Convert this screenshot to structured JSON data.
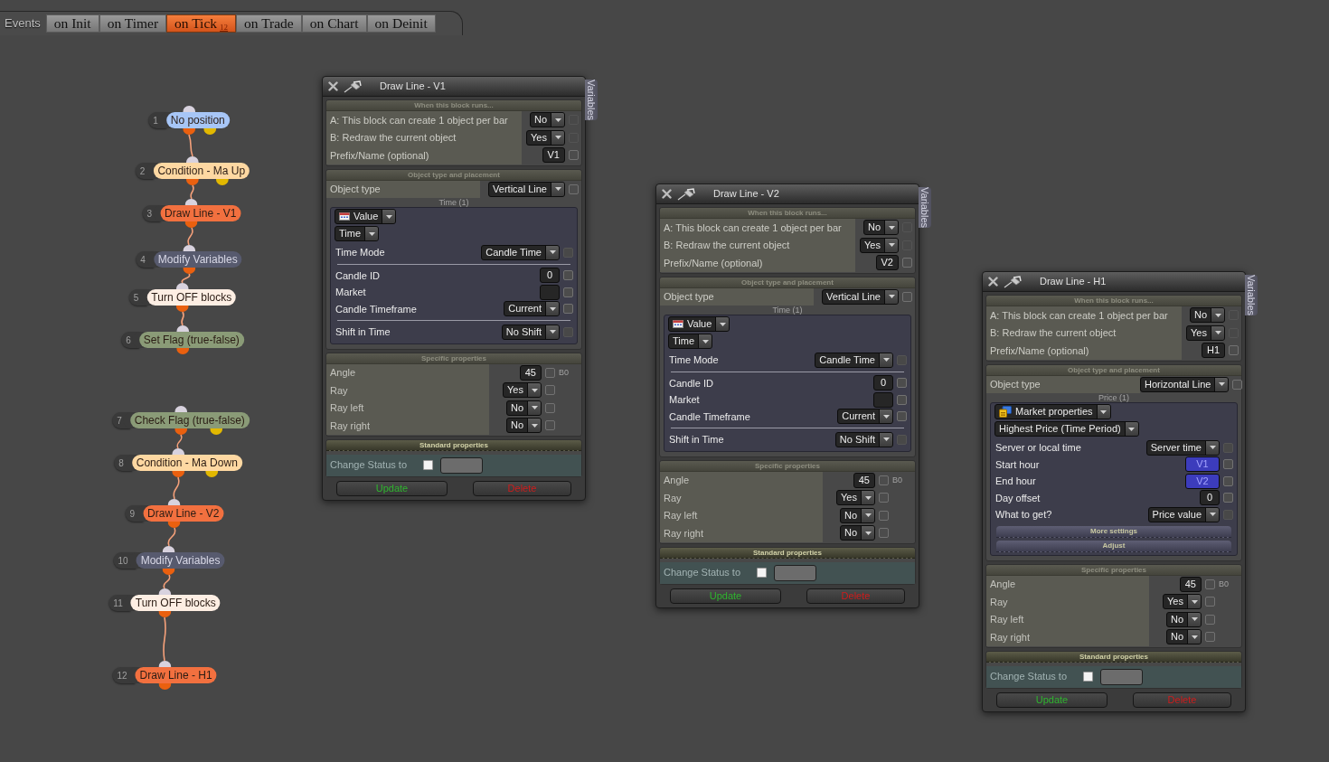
{
  "events_bar": {
    "label": "Events",
    "tabs": [
      {
        "label": "on Init",
        "selected": false
      },
      {
        "label": "on Timer",
        "selected": false
      },
      {
        "label": "on Tick",
        "selected": true,
        "badge": "12"
      },
      {
        "label": "on Trade",
        "selected": false
      },
      {
        "label": "on Chart",
        "selected": false
      },
      {
        "label": "on Deinit",
        "selected": false
      }
    ]
  },
  "flow": {
    "nodes": [
      {
        "number": "1",
        "label": "No position",
        "color": "#a7c6f7",
        "branch_port": true,
        "linked_to_next": true
      },
      {
        "number": "2",
        "label": "Condition - Ma Up",
        "color": "#fed8a2",
        "branch_port": true,
        "linked_to_next": true
      },
      {
        "number": "3",
        "label": "Draw Line - V1",
        "color": "#f2703f",
        "branch_port": false,
        "linked_to_next": true
      },
      {
        "number": "4",
        "label": "Modify Variables",
        "color": "#575a6e",
        "branch_port": false,
        "linked_to_next": true
      },
      {
        "number": "5",
        "label": "Turn OFF blocks",
        "color": "#fdeee3",
        "branch_port": false,
        "linked_to_next": true
      },
      {
        "number": "6",
        "label": "Set Flag (true-false)",
        "color": "#8a9b77",
        "branch_port": false,
        "linked_to_next": false
      },
      {
        "number": "7",
        "label": "Check Flag (true-false)",
        "color": "#8a9b77",
        "branch_port": true,
        "linked_to_next": true
      },
      {
        "number": "8",
        "label": "Condition - Ma Down",
        "color": "#fed8a2",
        "branch_port": true,
        "linked_to_next": true
      },
      {
        "number": "9",
        "label": "Draw Line - V2",
        "color": "#f2703f",
        "branch_port": false,
        "linked_to_next": true
      },
      {
        "number": "10",
        "label": "Modify Variables",
        "color": "#575a6e",
        "branch_port": false,
        "linked_to_next": true
      },
      {
        "number": "11",
        "label": "Turn OFF blocks",
        "color": "#fdeee3",
        "branch_port": false,
        "linked_to_next": true
      },
      {
        "number": "12",
        "label": "Draw Line - H1",
        "color": "#f2703f",
        "branch_port": false
      }
    ]
  },
  "panels": [
    {
      "title": "Draw Line - V1",
      "side_tab": "Variables",
      "sections": [
        {
          "kind": "run",
          "header": "When this block runs...",
          "rows": [
            {
              "kind": "dropdown",
              "label": "A: This block can create 1 object per bar",
              "value": "No",
              "checked": false,
              "check_disabled": true
            },
            {
              "kind": "dropdown",
              "label": "B: Redraw the current object",
              "value": "Yes",
              "checked": false,
              "check_disabled": true
            },
            {
              "kind": "input",
              "label": "Prefix/Name (optional)",
              "value": "V1",
              "checked": false,
              "check_disabled": false
            }
          ]
        },
        {
          "kind": "placement",
          "header": "Object type and placement",
          "rows": [
            {
              "kind": "dropdown",
              "label": "Object type",
              "value": "Vertical Line",
              "checked": false,
              "check_disabled": false
            }
          ],
          "group": {
            "caption": "Time (1)",
            "source": {
              "kind": "value",
              "label": "Value"
            },
            "field": "Time",
            "row_groups": [
              [
                {
                  "kind": "dropdown",
                  "label": "Time Mode",
                  "value": "Candle Time",
                  "checked": false,
                  "check_disabled": true
                }
              ],
              [
                {
                  "kind": "input",
                  "label": "Candle ID",
                  "value": "0",
                  "checked": false,
                  "check_disabled": false
                },
                {
                  "kind": "input",
                  "label": "Market",
                  "checked": false,
                  "check_disabled": false
                },
                {
                  "kind": "dropdown",
                  "label": "Candle Timeframe",
                  "value": "Current",
                  "checked": false,
                  "check_disabled": false
                }
              ],
              [
                {
                  "kind": "dropdown",
                  "label": "Shift in Time",
                  "value": "No Shift",
                  "checked": false,
                  "check_disabled": true
                }
              ]
            ]
          }
        },
        {
          "kind": "specific",
          "header": "Specific properties",
          "rows": [
            {
              "kind": "input",
              "label": "Angle",
              "value": "45",
              "checked": false,
              "check_disabled": false,
              "note": "B0"
            },
            {
              "kind": "dropdown",
              "label": "Ray",
              "value": "Yes",
              "checked": false,
              "check_disabled": false
            },
            {
              "kind": "dropdown",
              "label": "Ray left",
              "value": "No",
              "checked": false,
              "check_disabled": false
            },
            {
              "kind": "dropdown",
              "label": "Ray right",
              "value": "No",
              "checked": false,
              "check_disabled": false
            }
          ]
        }
      ],
      "standard": {
        "header": "Standard properties",
        "status_label": "Change Status to",
        "status_checked": false
      },
      "buttons": [
        {
          "kind": "update",
          "label": "Update"
        },
        {
          "kind": "delete",
          "label": "Delete"
        }
      ]
    },
    {
      "title": "Draw Line - V2",
      "side_tab": "Variables",
      "sections": [
        {
          "kind": "run",
          "header": "When this block runs...",
          "rows": [
            {
              "kind": "dropdown",
              "label": "A: This block can create 1 object per bar",
              "value": "No",
              "checked": false,
              "check_disabled": true
            },
            {
              "kind": "dropdown",
              "label": "B: Redraw the current object",
              "value": "Yes",
              "checked": false,
              "check_disabled": true
            },
            {
              "kind": "input",
              "label": "Prefix/Name (optional)",
              "value": "V2",
              "checked": false,
              "check_disabled": false
            }
          ]
        },
        {
          "kind": "placement",
          "header": "Object type and placement",
          "rows": [
            {
              "kind": "dropdown",
              "label": "Object type",
              "value": "Vertical Line",
              "checked": false,
              "check_disabled": false
            }
          ],
          "group": {
            "caption": "Time (1)",
            "source": {
              "kind": "value",
              "label": "Value"
            },
            "field": "Time",
            "row_groups": [
              [
                {
                  "kind": "dropdown",
                  "label": "Time Mode",
                  "value": "Candle Time",
                  "checked": false,
                  "check_disabled": true
                }
              ],
              [
                {
                  "kind": "input",
                  "label": "Candle ID",
                  "value": "0",
                  "checked": false,
                  "check_disabled": false
                },
                {
                  "kind": "input",
                  "label": "Market",
                  "checked": false,
                  "check_disabled": false
                },
                {
                  "kind": "dropdown",
                  "label": "Candle Timeframe",
                  "value": "Current",
                  "checked": false,
                  "check_disabled": false
                }
              ],
              [
                {
                  "kind": "dropdown",
                  "label": "Shift in Time",
                  "value": "No Shift",
                  "checked": false,
                  "check_disabled": true
                }
              ]
            ]
          }
        },
        {
          "kind": "specific",
          "header": "Specific properties",
          "rows": [
            {
              "kind": "input",
              "label": "Angle",
              "value": "45",
              "checked": false,
              "check_disabled": false,
              "note": "B0"
            },
            {
              "kind": "dropdown",
              "label": "Ray",
              "value": "Yes",
              "checked": false,
              "check_disabled": false
            },
            {
              "kind": "dropdown",
              "label": "Ray left",
              "value": "No",
              "checked": false,
              "check_disabled": false
            },
            {
              "kind": "dropdown",
              "label": "Ray right",
              "value": "No",
              "checked": false,
              "check_disabled": false
            }
          ]
        }
      ],
      "standard": {
        "header": "Standard properties",
        "status_label": "Change Status to",
        "status_checked": false
      },
      "buttons": [
        {
          "kind": "update",
          "label": "Update"
        },
        {
          "kind": "delete",
          "label": "Delete"
        }
      ]
    },
    {
      "title": "Draw Line - H1",
      "side_tab": "Variables",
      "sections": [
        {
          "kind": "run",
          "header": "When this block runs...",
          "rows": [
            {
              "kind": "dropdown",
              "label": "A: This block can create 1 object per bar",
              "value": "No",
              "checked": false,
              "check_disabled": true
            },
            {
              "kind": "dropdown",
              "label": "B: Redraw the current object",
              "value": "Yes",
              "checked": false,
              "check_disabled": true
            },
            {
              "kind": "input",
              "label": "Prefix/Name (optional)",
              "value": "H1",
              "checked": false,
              "check_disabled": false
            }
          ]
        },
        {
          "kind": "placement",
          "header": "Object type and placement",
          "rows": [
            {
              "kind": "dropdown",
              "label": "Object type",
              "value": "Horizontal Line",
              "checked": false,
              "check_disabled": false
            }
          ],
          "group": {
            "caption": "Price (1)",
            "source": {
              "kind": "market",
              "label": "Market properties"
            },
            "field": "Highest Price (Time Period)",
            "row_groups": [
              [
                {
                  "kind": "dropdown",
                  "label": "Server or local time",
                  "value": "Server time",
                  "checked": false,
                  "check_disabled": true
                },
                {
                  "kind": "input",
                  "label": "Start hour",
                  "value": "V1",
                  "variable": true,
                  "checked": false,
                  "check_disabled": false
                },
                {
                  "kind": "input",
                  "label": "End hour",
                  "value": "V2",
                  "variable": true,
                  "checked": false,
                  "check_disabled": false
                },
                {
                  "kind": "input",
                  "label": "Day offset",
                  "value": "0",
                  "checked": false,
                  "check_disabled": false
                },
                {
                  "kind": "dropdown",
                  "label": "What to get?",
                  "value": "Price value",
                  "checked": false,
                  "check_disabled": true
                }
              ]
            ],
            "actions": [
              "More settings",
              "Adjust"
            ]
          }
        },
        {
          "kind": "specific",
          "header": "Specific properties",
          "rows": [
            {
              "kind": "input",
              "label": "Angle",
              "value": "45",
              "checked": false,
              "check_disabled": false,
              "note": "B0"
            },
            {
              "kind": "dropdown",
              "label": "Ray",
              "value": "Yes",
              "checked": false,
              "check_disabled": false
            },
            {
              "kind": "dropdown",
              "label": "Ray left",
              "value": "No",
              "checked": false,
              "check_disabled": false
            },
            {
              "kind": "dropdown",
              "label": "Ray right",
              "value": "No",
              "checked": false,
              "check_disabled": false
            }
          ]
        }
      ],
      "standard": {
        "header": "Standard properties",
        "status_label": "Change Status to",
        "status_checked": false
      },
      "buttons": [
        {
          "kind": "update",
          "label": "Update"
        },
        {
          "kind": "delete",
          "label": "Delete"
        }
      ]
    }
  ]
}
